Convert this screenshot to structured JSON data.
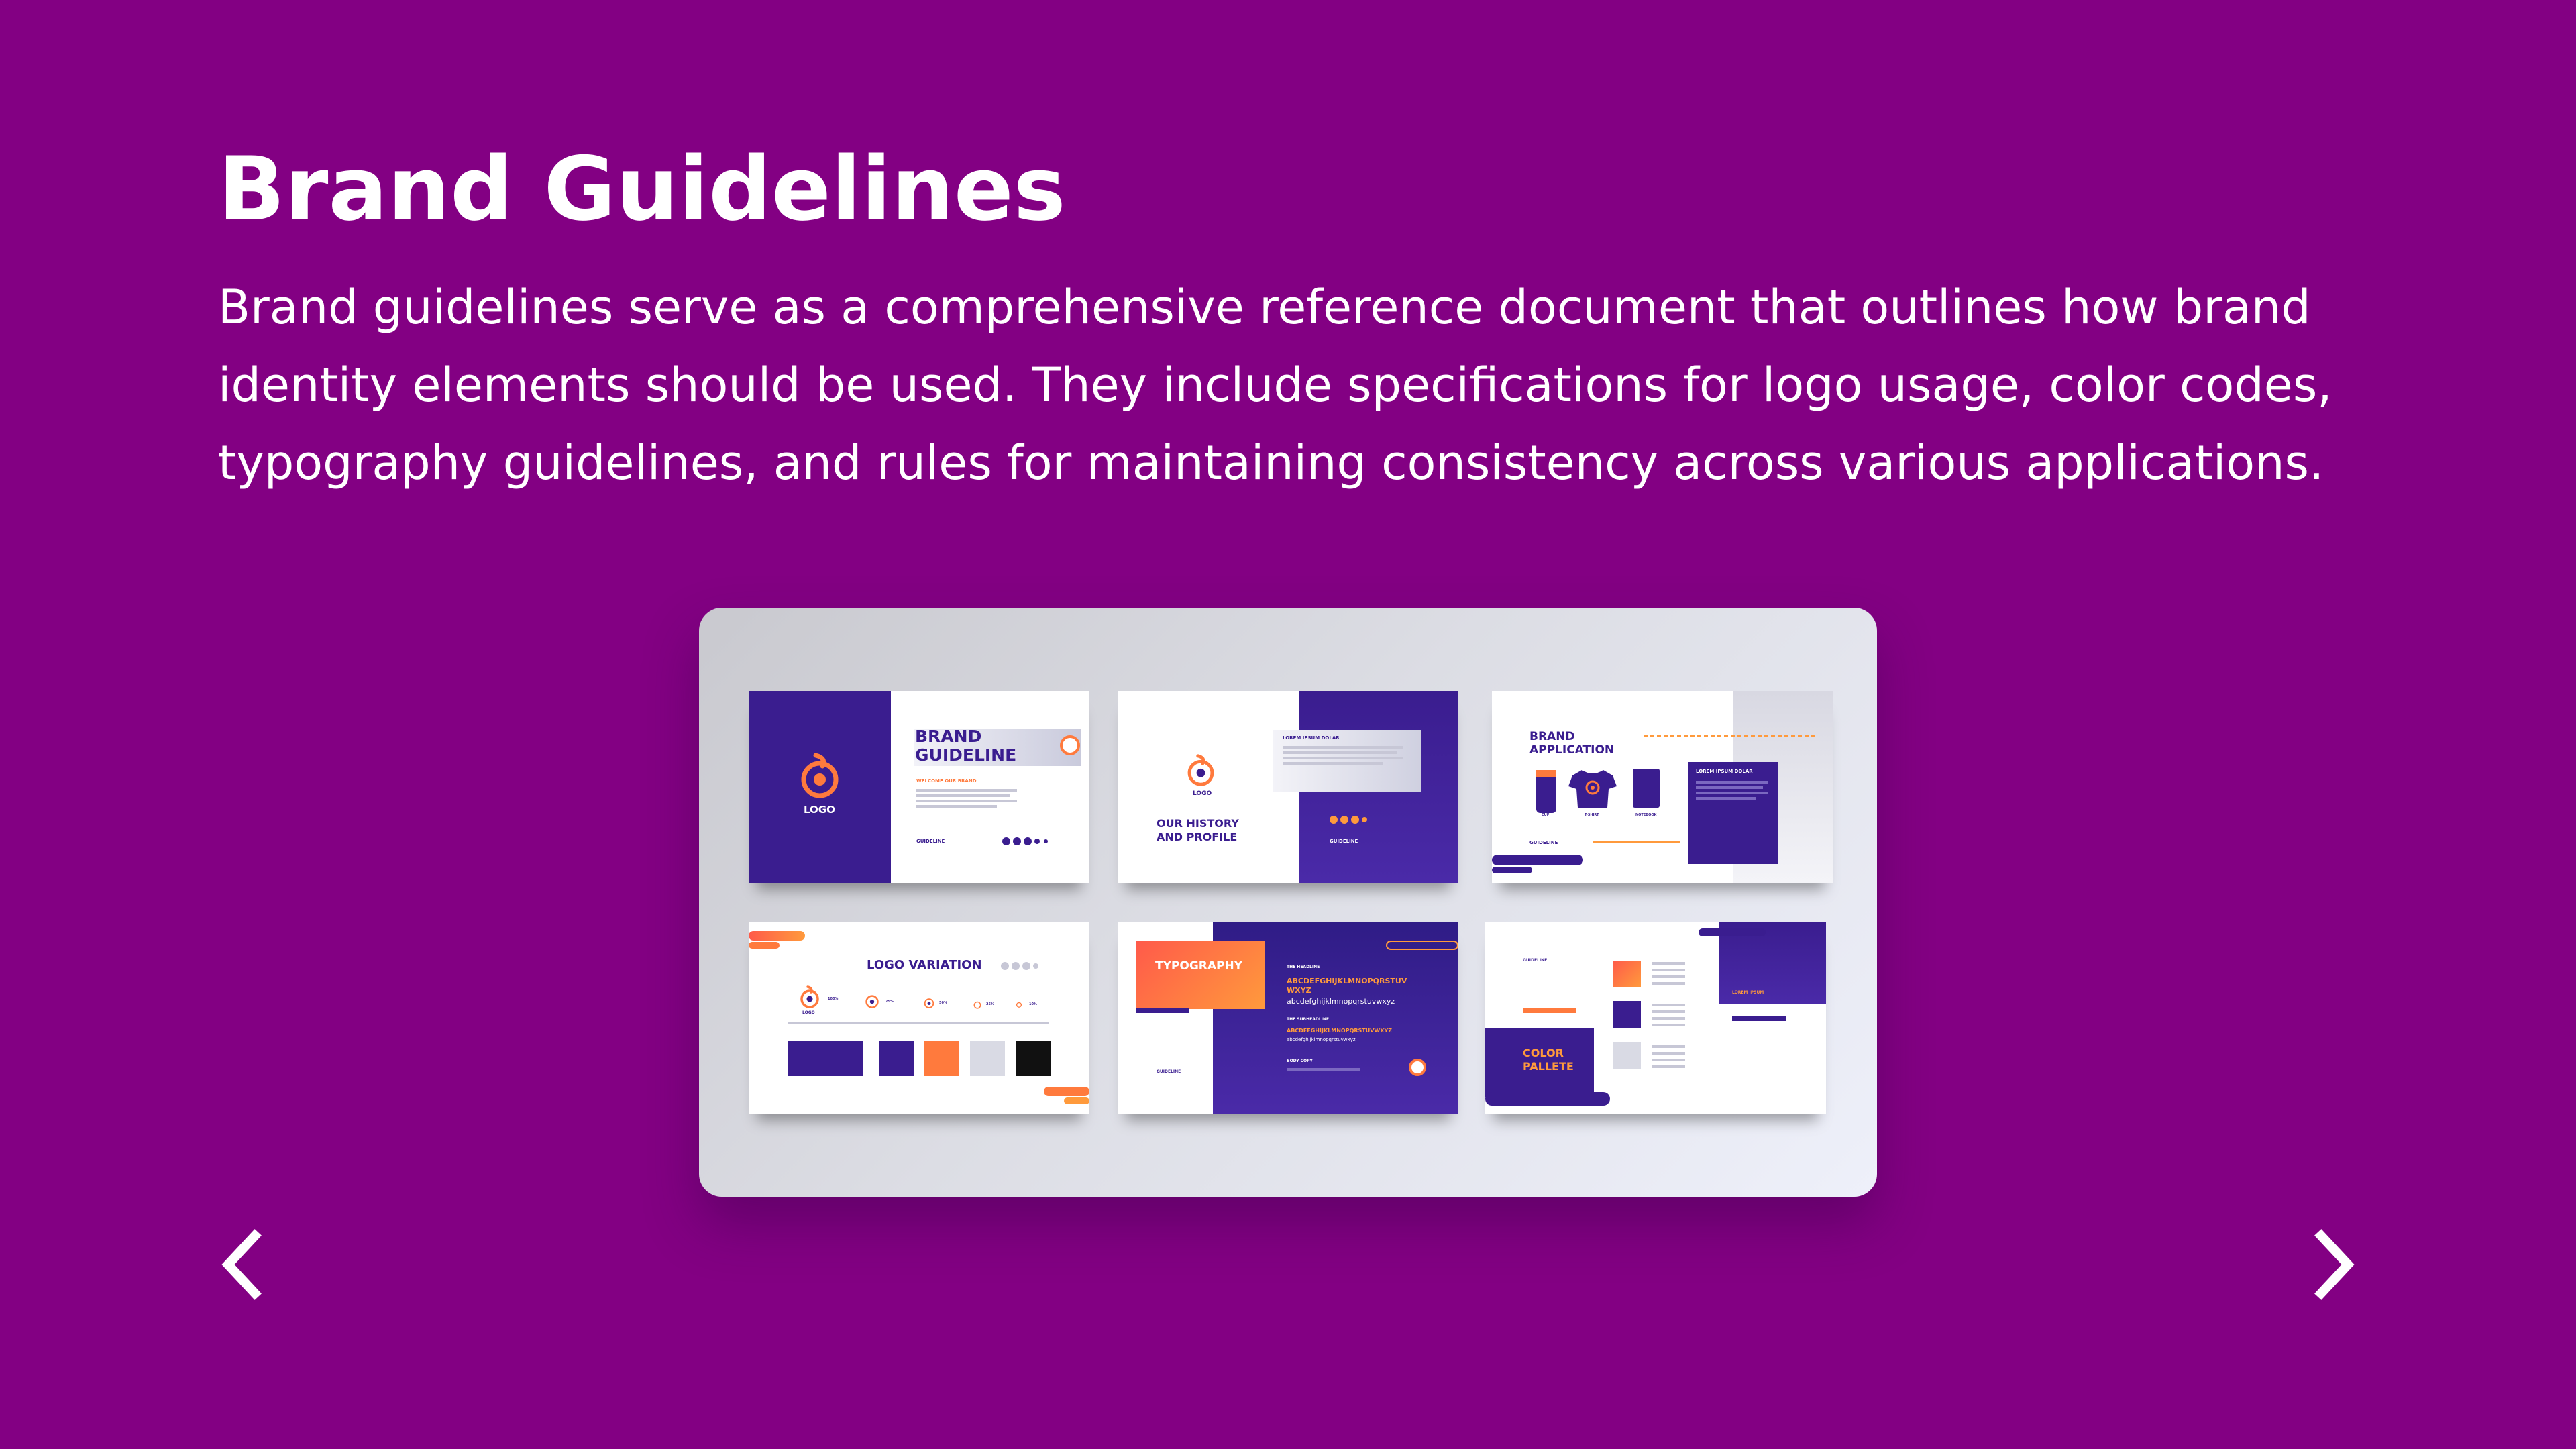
{
  "heading": "Brand Guidelines",
  "description": "Brand guidelines serve as a comprehensive reference document that outlines how brand identity elements should be used. They include specifications for logo usage, color codes, typography guidelines, and rules for maintaining consistency across various applications.",
  "colors": {
    "background": "#830083",
    "brand_purple": "#3a1d8f",
    "brand_orange": "#ff7a3d",
    "gradient_orange": "#ff9a3c"
  },
  "navigation": {
    "prev_icon": "chevron-left-icon",
    "next_icon": "chevron-right-icon"
  },
  "slides": {
    "cover": {
      "logo": "LOGO",
      "title_line1": "BRAND",
      "title_line2": "GUIDELINE",
      "subtitle": "WELCOME OUR BRAND",
      "footer": "GUIDELINE"
    },
    "history": {
      "logo": "LOGO",
      "title_line1": "OUR HISTORY",
      "title_line2": "AND PROFILE",
      "box_title": "LOREM IPSUM DOLAR",
      "footer": "GUIDELINE"
    },
    "application": {
      "title_line1": "BRAND",
      "title_line2": "APPLICATION",
      "box_title": "LOREM IPSUM DOLAR",
      "footer": "GUIDELINE",
      "items": [
        "CUP",
        "T-SHIRT",
        "NOTEBOOK"
      ]
    },
    "variation": {
      "title": "LOGO VARIATION",
      "logo": "LOGO",
      "sizes": [
        "100%",
        "75%",
        "50%",
        "25%",
        "10%"
      ]
    },
    "typography": {
      "title": "TYPOGRAPHY",
      "headline_label": "THE HEADLINE",
      "headline_upper": "ABCDEFGHIJKLMNOPQRSTUV",
      "headline_upper2": "WXYZ",
      "headline_lower": "abcdefghijklmnopqrstuvwxyz",
      "subheadline_label": "THE SUBHEADLINE",
      "subheadline_upper": "ABCDEFGHIJKLMNOPQRSTUVWXYZ",
      "subheadline_lower": "abcdefghijklmnopqrstuvwxyz",
      "body_label": "BODY COPY",
      "footer": "GUIDELINE"
    },
    "palette": {
      "title_line1": "COLOR",
      "title_line2": "PALLETE",
      "footer": "GUIDELINE",
      "box_title": "LOREM IPSUM"
    }
  }
}
